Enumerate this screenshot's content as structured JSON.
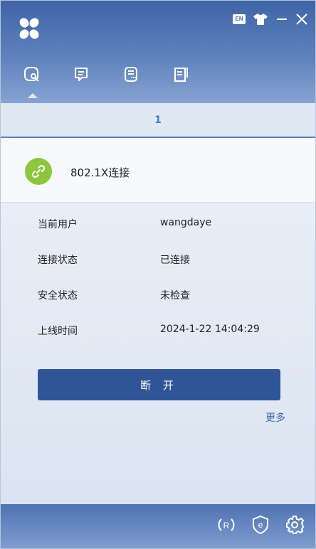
{
  "header": {
    "lang_badge": "EN",
    "icons": [
      "logo-icon",
      "language-icon",
      "skin-icon",
      "minimize-icon",
      "close-icon"
    ],
    "tabs": [
      {
        "name": "connection-tab",
        "icon": "connection-icon",
        "active": true
      },
      {
        "name": "messages-tab",
        "icon": "message-icon",
        "active": false
      },
      {
        "name": "log-tab",
        "icon": "log-icon",
        "active": false
      },
      {
        "name": "notes-tab",
        "icon": "notes-icon",
        "active": false
      }
    ]
  },
  "pager": {
    "page": "1"
  },
  "connection": {
    "name": "802.1X连接",
    "icon": "link-icon"
  },
  "info": {
    "user_label": "当前用户",
    "user_value": "wangdaye",
    "status_label": "连接状态",
    "status_value": "已连接",
    "security_label": "安全状态",
    "security_value": "未检查",
    "online_label": "上线时间",
    "online_value": "2024-1-22 14:04:29"
  },
  "actions": {
    "disconnect_label": "断 开",
    "more_label": "更多"
  },
  "footer": {
    "icons": [
      "refresh-icon",
      "ie-browser-icon",
      "settings-icon"
    ]
  },
  "colors": {
    "header_top": "#3f64a6",
    "accent": "#2f5596",
    "link": "#3a66b0",
    "connected_green": "#8cc63f"
  }
}
